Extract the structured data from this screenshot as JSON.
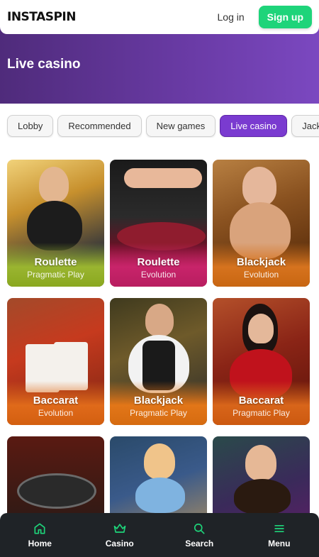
{
  "header": {
    "logo": "INSTASPIN",
    "login_label": "Log in",
    "signup_label": "Sign up"
  },
  "hero": {
    "title": "Live casino"
  },
  "tabs": [
    {
      "label": "Lobby"
    },
    {
      "label": "Recommended"
    },
    {
      "label": "New games"
    },
    {
      "label": "Live casino"
    },
    {
      "label": "Jackpots"
    }
  ],
  "games": [
    {
      "title": "Roulette",
      "provider": "Pragmatic Play"
    },
    {
      "title": "Roulette",
      "provider": "Evolution"
    },
    {
      "title": "Blackjack",
      "provider": "Evolution"
    },
    {
      "title": "Baccarat",
      "provider": "Evolution"
    },
    {
      "title": "Blackjack",
      "provider": "Pragmatic Play"
    },
    {
      "title": "Baccarat",
      "provider": "Pragmatic Play"
    }
  ],
  "bottom_nav": [
    {
      "label": "Home",
      "icon": "home-icon"
    },
    {
      "label": "Casino",
      "icon": "crown-icon"
    },
    {
      "label": "Search",
      "icon": "search-icon"
    },
    {
      "label": "Menu",
      "icon": "menu-icon"
    }
  ],
  "colors": {
    "accent": "#7a3bd0",
    "signup": "#1ed47a",
    "icon": "#1ed47a",
    "nav_bg": "#1f2327"
  }
}
